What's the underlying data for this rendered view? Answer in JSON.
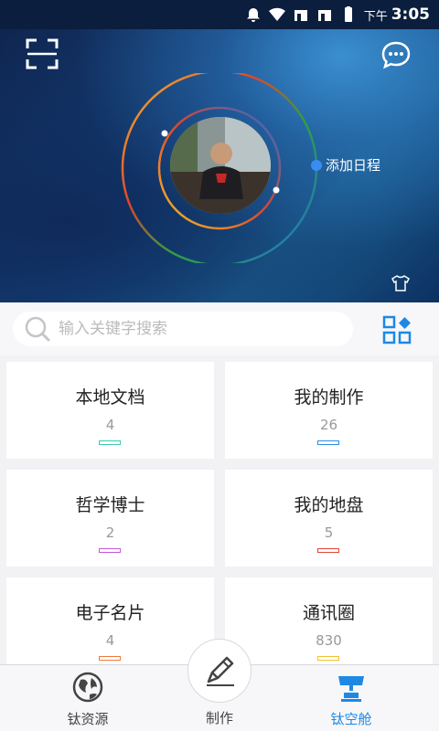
{
  "status_bar": {
    "ampm": "下午",
    "time": "3:05"
  },
  "hero": {
    "scan_icon": "scan-icon",
    "message_icon": "chat-bubble-icon",
    "schedule_label": "添加日程",
    "theme_icon": "tshirt-icon",
    "ring_colors": [
      "#f4c22b",
      "#2f9e44",
      "#1e6fd9",
      "#e0452a"
    ]
  },
  "search": {
    "placeholder": "输入关键字搜索",
    "icon": "search-icon"
  },
  "tiles": [
    {
      "name": "本地文档",
      "count": "4",
      "color": "#3cc8b4"
    },
    {
      "name": "我的制作",
      "count": "26",
      "color": "#2f8ee6"
    },
    {
      "name": "哲学博士",
      "count": "2",
      "color": "#c05bd4"
    },
    {
      "name": "我的地盘",
      "count": "5",
      "color": "#e0453a"
    },
    {
      "name": "电子名片",
      "count": "4",
      "color": "#f07a3a"
    },
    {
      "name": "通讯圈",
      "count": "830",
      "color": "#f2c230"
    }
  ],
  "nav": {
    "left": {
      "label": "钛资源",
      "icon": "globe-icon"
    },
    "center": {
      "label": "制作",
      "icon": "pen-icon"
    },
    "right": {
      "label": "钛空舱",
      "icon": "capsule-icon",
      "active": true
    },
    "accent": "#1e88e5"
  }
}
